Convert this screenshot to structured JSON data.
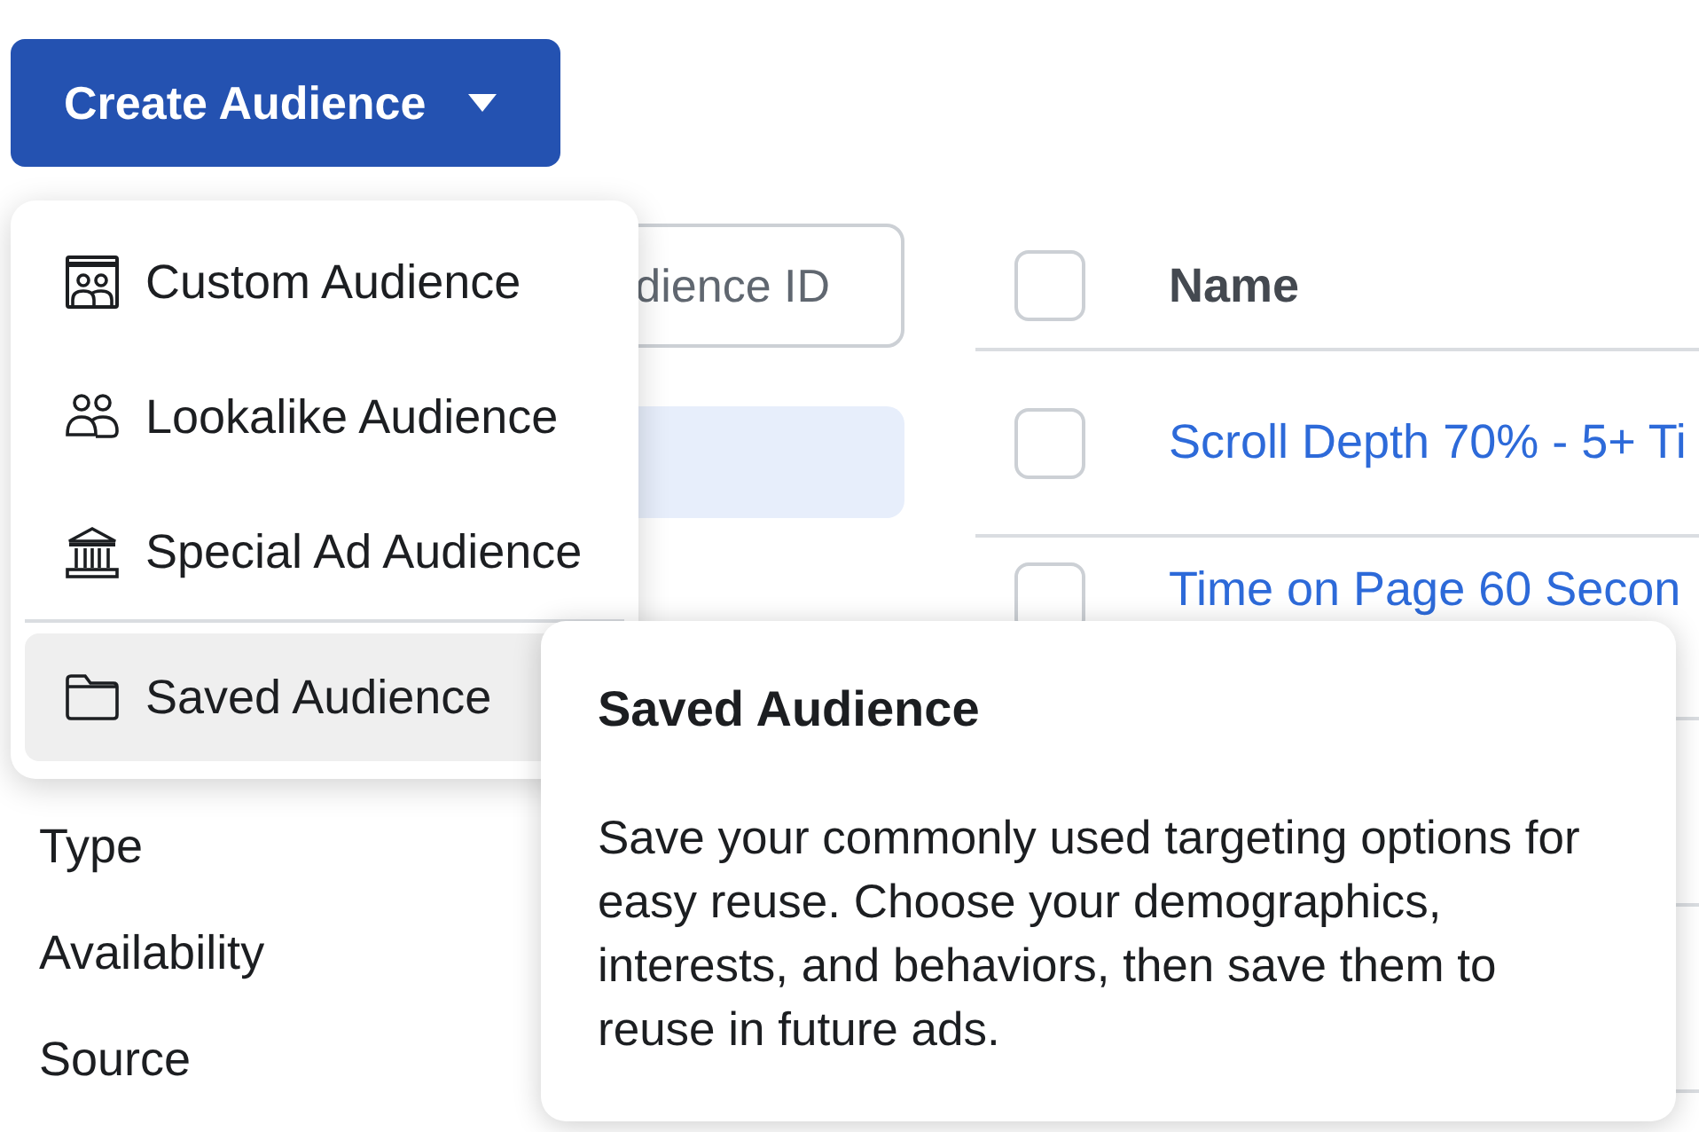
{
  "create_button": {
    "label": "Create Audience"
  },
  "search": {
    "placeholder": "dience ID"
  },
  "filters": [
    "Type",
    "Availability",
    "Source"
  ],
  "table": {
    "header": {
      "label": "Name",
      "checked": false
    },
    "rows": [
      {
        "name": "Scroll Depth 70% - 5+ Ti",
        "checked": false
      },
      {
        "name": "Time on Page 60 Secon",
        "checked": false
      }
    ]
  },
  "menu": {
    "items": [
      {
        "kind": "custom",
        "label": "Custom Audience",
        "selected": false
      },
      {
        "kind": "lookalike",
        "label": "Lookalike Audience",
        "selected": false
      },
      {
        "kind": "special",
        "label": "Special Ad Audience",
        "selected": false
      },
      {
        "kind": "saved",
        "label": "Saved Audience",
        "selected": true
      }
    ]
  },
  "tooltip": {
    "title": "Saved Audience",
    "body": "Save your commonly used targeting options for easy reuse. Choose your demographics, interests, and behaviors, then save them to reuse in future ads."
  }
}
